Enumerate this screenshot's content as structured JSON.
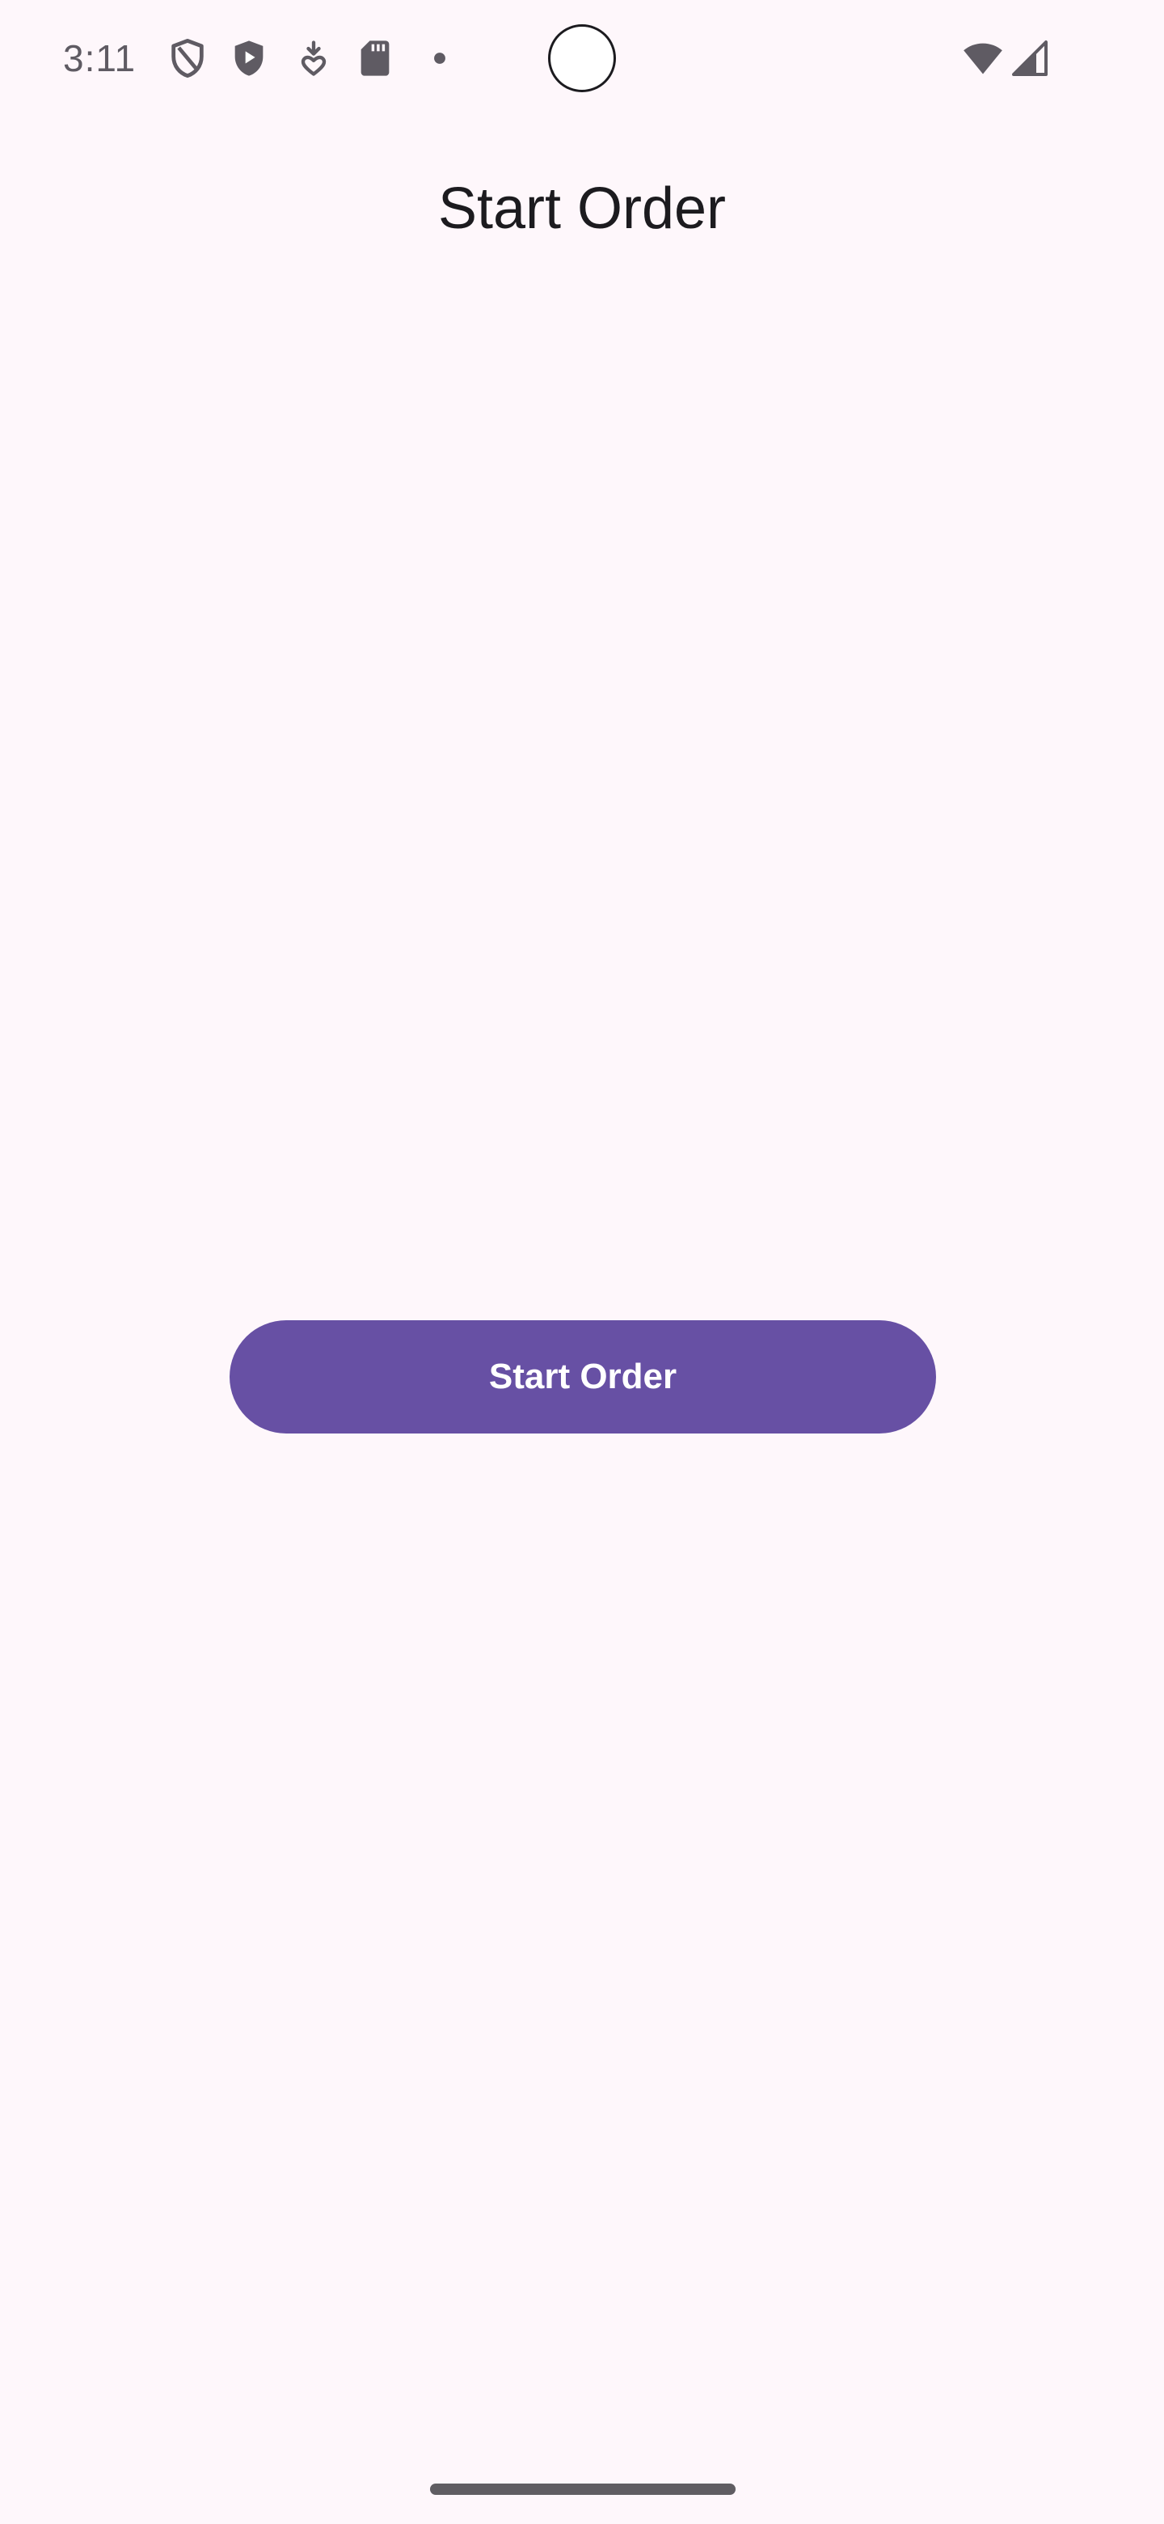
{
  "status_bar": {
    "time": "3:11",
    "icons": [
      "shield-outline-icon",
      "shield-play-icon",
      "download-heart-icon",
      "sd-card-icon",
      "notification-dot-icon",
      "wifi-icon",
      "cellular-signal-icon"
    ],
    "icon_color": "#5f5b63"
  },
  "header": {
    "title": "Start Order"
  },
  "main": {
    "start_button_label": "Start Order"
  },
  "colors": {
    "background": "#fef7fb",
    "accent": "#6750a4",
    "on_accent": "#ffffff",
    "text": "#1c1b1f"
  }
}
